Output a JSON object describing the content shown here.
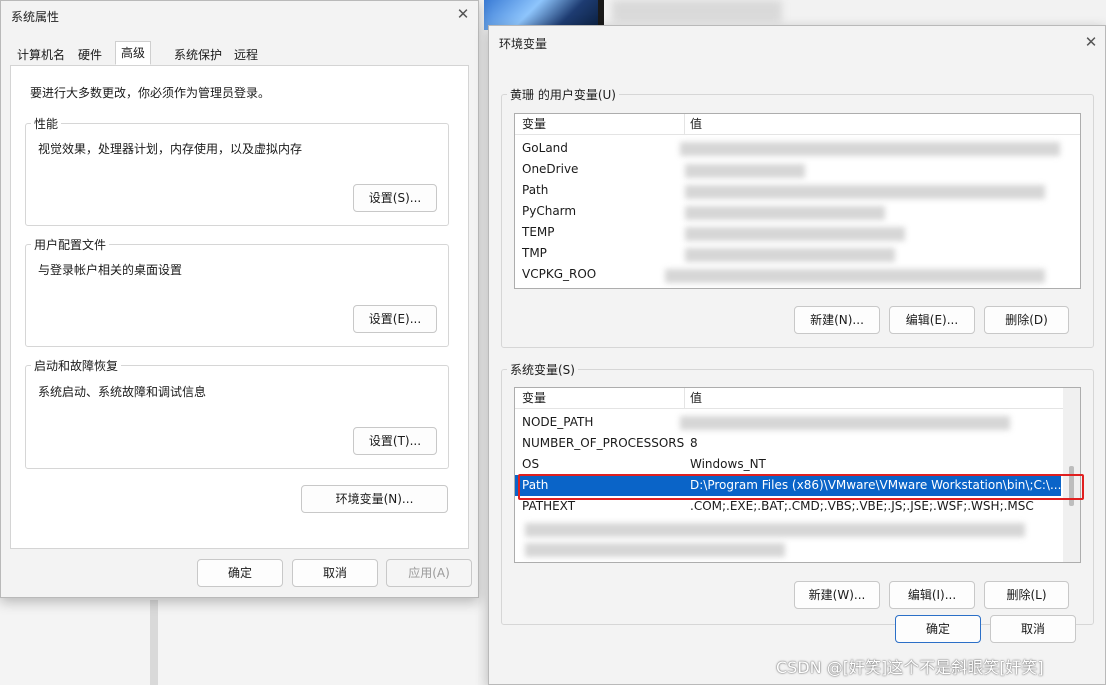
{
  "sysprops": {
    "title": "系统属性",
    "tabs": [
      "计算机名",
      "硬件",
      "高级",
      "系统保护",
      "远程"
    ],
    "notice": "要进行大多数更改，你必须作为管理员登录。",
    "performance": {
      "label": "性能",
      "desc": "视觉效果，处理器计划，内存使用，以及虚拟内存",
      "button": "设置(S)..."
    },
    "profiles": {
      "label": "用户配置文件",
      "desc": "与登录帐户相关的桌面设置",
      "button": "设置(E)..."
    },
    "startup": {
      "label": "启动和故障恢复",
      "desc": "系统启动、系统故障和调试信息",
      "button": "设置(T)..."
    },
    "env_button": "环境变量(N)...",
    "ok": "确定",
    "cancel": "取消",
    "apply": "应用(A)"
  },
  "envvars": {
    "title": "环境变量",
    "user_group_label": "黄珊 的用户变量(U)",
    "columns": [
      "变量",
      "值"
    ],
    "user_vars": [
      {
        "name": "GoLand",
        "value": ""
      },
      {
        "name": "OneDrive",
        "value": ""
      },
      {
        "name": "Path",
        "value": ""
      },
      {
        "name": "PyCharm",
        "value": ""
      },
      {
        "name": "TEMP",
        "value": ""
      },
      {
        "name": "TMP",
        "value": ""
      },
      {
        "name": "VCPKG_ROO",
        "value": ""
      }
    ],
    "user_buttons": {
      "new": "新建(N)...",
      "edit": "编辑(E)...",
      "delete": "删除(D)"
    },
    "sys_group_label": "系统变量(S)",
    "sys_vars": [
      {
        "name": "NODE_PATH",
        "value": ""
      },
      {
        "name": "NUMBER_OF_PROCESSORS",
        "value": "8"
      },
      {
        "name": "OS",
        "value": "Windows_NT"
      },
      {
        "name": "Path",
        "value": "D:\\Program Files (x86)\\VMware\\VMware Workstation\\bin\\;C:\\..."
      },
      {
        "name": "PATHEXT",
        "value": ".COM;.EXE;.BAT;.CMD;.VBS;.VBE;.JS;.JSE;.WSF;.WSH;.MSC"
      }
    ],
    "sys_buttons": {
      "new": "新建(W)...",
      "edit": "编辑(I)...",
      "delete": "删除(L)"
    },
    "ok": "确定",
    "cancel": "取消"
  },
  "watermark": "CSDN @[奸笑]这个不是斜眼笑[奸笑]",
  "colors": {
    "selection": "#0a64c8",
    "highlight_box": "#e02020"
  },
  "icons": [
    "close-icon"
  ]
}
